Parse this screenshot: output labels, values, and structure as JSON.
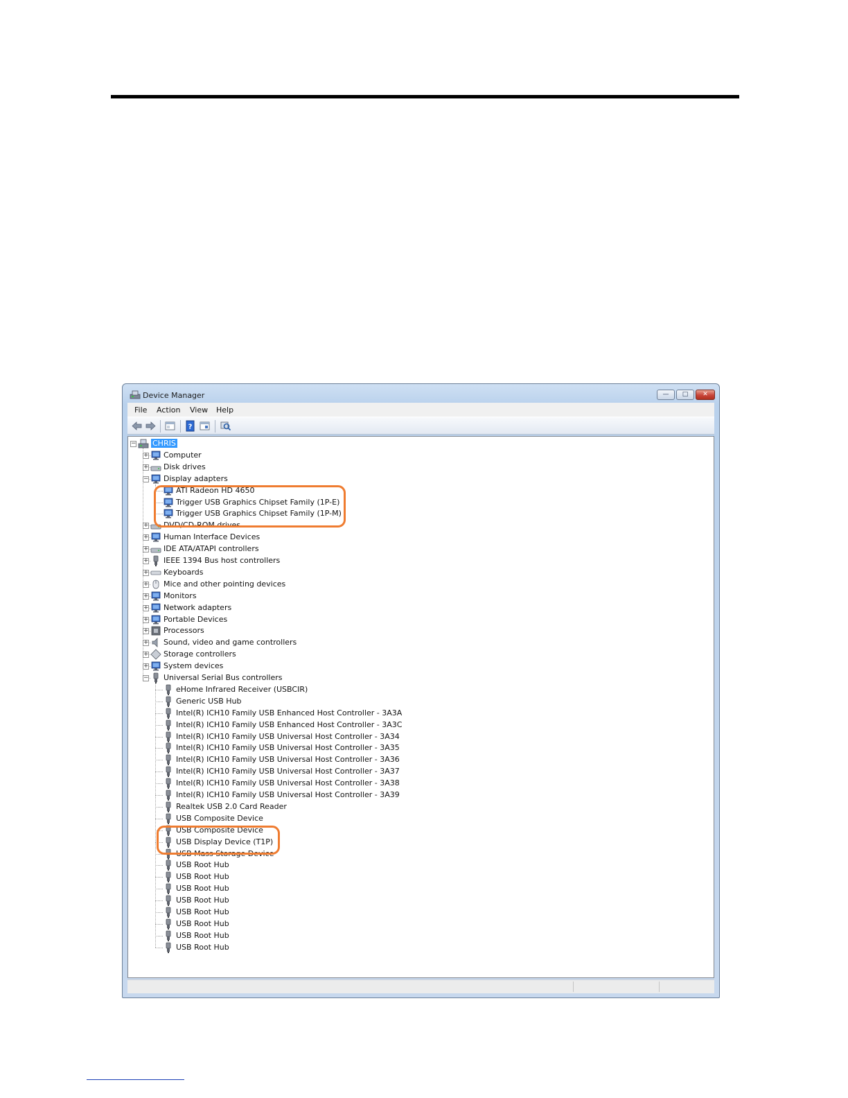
{
  "window": {
    "title": "Device Manager",
    "minimize": "—",
    "maximize": "□",
    "close": "✕"
  },
  "menu": [
    "File",
    "Action",
    "View",
    "Help"
  ],
  "toolbar_icons": [
    "back-arrow-icon",
    "forward-arrow-icon",
    "properties-icon",
    "help-icon",
    "view-icon",
    "scan-hardware-icon"
  ],
  "tree": {
    "root": "CHRIS",
    "categories": [
      {
        "label": "Computer",
        "icon": "computer-icon"
      },
      {
        "label": "Disk drives",
        "icon": "disk-drive-icon"
      },
      {
        "label": "Display adapters",
        "icon": "display-adapter-icon",
        "expanded": true
      },
      {
        "label": "DVD/CD-ROM drives",
        "icon": "dvd-drive-icon"
      },
      {
        "label": "Human Interface Devices",
        "icon": "hid-icon"
      },
      {
        "label": "IDE ATA/ATAPI controllers",
        "icon": "ide-controller-icon"
      },
      {
        "label": "IEEE 1394 Bus host controllers",
        "icon": "ieee1394-icon"
      },
      {
        "label": "Keyboards",
        "icon": "keyboard-icon"
      },
      {
        "label": "Mice and other pointing devices",
        "icon": "mouse-icon"
      },
      {
        "label": "Monitors",
        "icon": "monitor-icon"
      },
      {
        "label": "Network adapters",
        "icon": "network-adapter-icon"
      },
      {
        "label": "Portable Devices",
        "icon": "portable-device-icon"
      },
      {
        "label": "Processors",
        "icon": "processor-icon"
      },
      {
        "label": "Sound, video and game controllers",
        "icon": "sound-icon"
      },
      {
        "label": "Storage controllers",
        "icon": "storage-controller-icon"
      },
      {
        "label": "System devices",
        "icon": "system-device-icon"
      },
      {
        "label": "Universal Serial Bus controllers",
        "icon": "usb-icon",
        "expanded": true
      }
    ],
    "display_adapters": [
      "ATI Radeon HD 4650",
      "Trigger USB Graphics Chipset Family (1P-E)",
      "Trigger USB Graphics Chipset Family (1P-M)"
    ],
    "usb_controllers": [
      "eHome Infrared Receiver (USBCIR)",
      "Generic USB Hub",
      "Intel(R) ICH10 Family USB Enhanced Host Controller - 3A3A",
      "Intel(R) ICH10 Family USB Enhanced Host Controller - 3A3C",
      "Intel(R) ICH10 Family USB Universal Host Controller - 3A34",
      "Intel(R) ICH10 Family USB Universal Host Controller - 3A35",
      "Intel(R) ICH10 Family USB Universal Host Controller - 3A36",
      "Intel(R) ICH10 Family USB Universal Host Controller - 3A37",
      "Intel(R) ICH10 Family USB Universal Host Controller - 3A38",
      "Intel(R) ICH10 Family USB Universal Host Controller - 3A39",
      "Realtek USB 2.0 Card Reader",
      "USB Composite Device",
      "USB Composite Device",
      "USB Display Device (T1P)",
      "USB Mass Storage Device",
      "USB Root Hub",
      "USB Root Hub",
      "USB Root Hub",
      "USB Root Hub",
      "USB Root Hub",
      "USB Root Hub",
      "USB Root Hub",
      "USB Root Hub"
    ]
  },
  "colors": {
    "highlight_outline": "#ef7c30",
    "selection": "#3399ff"
  }
}
